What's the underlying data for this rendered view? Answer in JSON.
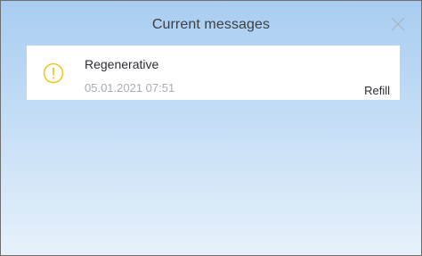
{
  "dialog": {
    "title": "Current messages",
    "close_icon": "close-icon"
  },
  "messages": [
    {
      "icon": "warning-icon",
      "icon_color": "#f3c623",
      "title": "Regenerative",
      "timestamp": "05.01.2021 07:51",
      "action": "Refill"
    }
  ],
  "colors": {
    "background_top": "#a9cdf1",
    "background_bottom": "#e7f1fb",
    "card": "#ffffff"
  }
}
